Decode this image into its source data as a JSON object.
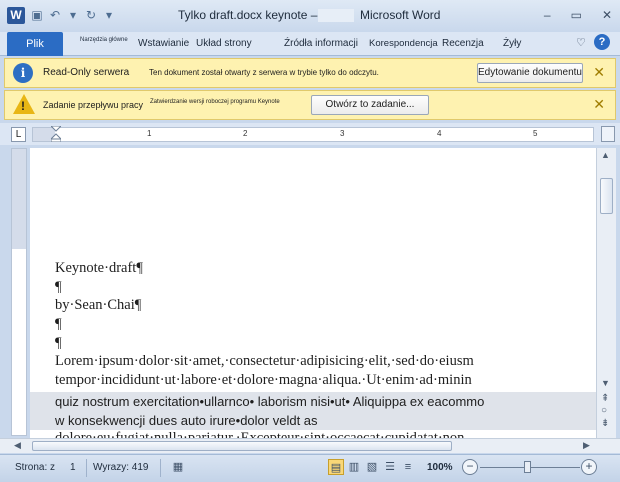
{
  "window": {
    "app_icon": "W",
    "doc_title": "Tylko draft.docx keynote –",
    "app_name": "Microsoft Word",
    "minimize": "–",
    "maximize": "▭",
    "close": "✕"
  },
  "qat": {
    "save": "▣",
    "undo": "↶",
    "dropdown1": "▾",
    "redo": "↻",
    "customize": "▾"
  },
  "ribbon": {
    "file_tab": "Plik",
    "tabs": [
      "Narzędzia główne",
      "Wstawianie",
      "Układ strony",
      "Źródła informacji",
      "Korespondencja",
      "Recenzja",
      "Żyły"
    ],
    "minimize_ribbon": "♡",
    "help": "?"
  },
  "message_bars": [
    {
      "label": "Read-Only serwera",
      "text": "Ten dokument został otwarty z serwera w trybie tylko do odczytu.",
      "button": "Edytowanie dokumentu",
      "close": "✕"
    },
    {
      "label": "Zadanie przepływu pracy",
      "text": "Zatwierdzanie wersji roboczej programu Keynote",
      "button": "Otwórz to zadanie...",
      "close": "✕"
    }
  ],
  "ruler": {
    "tab_selector": "L",
    "numbers": [
      "1",
      "2",
      "3",
      "4",
      "5"
    ]
  },
  "document": {
    "lines": [
      "Keynote·draft¶",
      "¶",
      "by·Sean·Chai¶",
      "¶",
      "¶",
      "Lorem·ipsum·dolor·sit·amet,·consectetur·adipisicing·elit,·sed·do·eiusm",
      "tempor·incididunt·ut·labore·et·dolore·magna·aliqua.·Ut·enim·ad·minin"
    ],
    "tracked_lines": [
      "quiz nostrum exercitation•ullarnco• laborism nisi•ut• Aliquippa ex eacommo",
      "w konsekwencji dues auto irure•dolor veldt as"
    ],
    "partial_line": "dolore·eu·fugiat·nulla·pariatur.·Excepteur·sint·occaecat·cupidatat·non"
  },
  "status": {
    "page_label": "Strona: z",
    "page_number": "1",
    "words_label": "Wyrazy: 419",
    "zoom_percent": "100%",
    "zoom_minus": "−",
    "zoom_plus": "+"
  }
}
